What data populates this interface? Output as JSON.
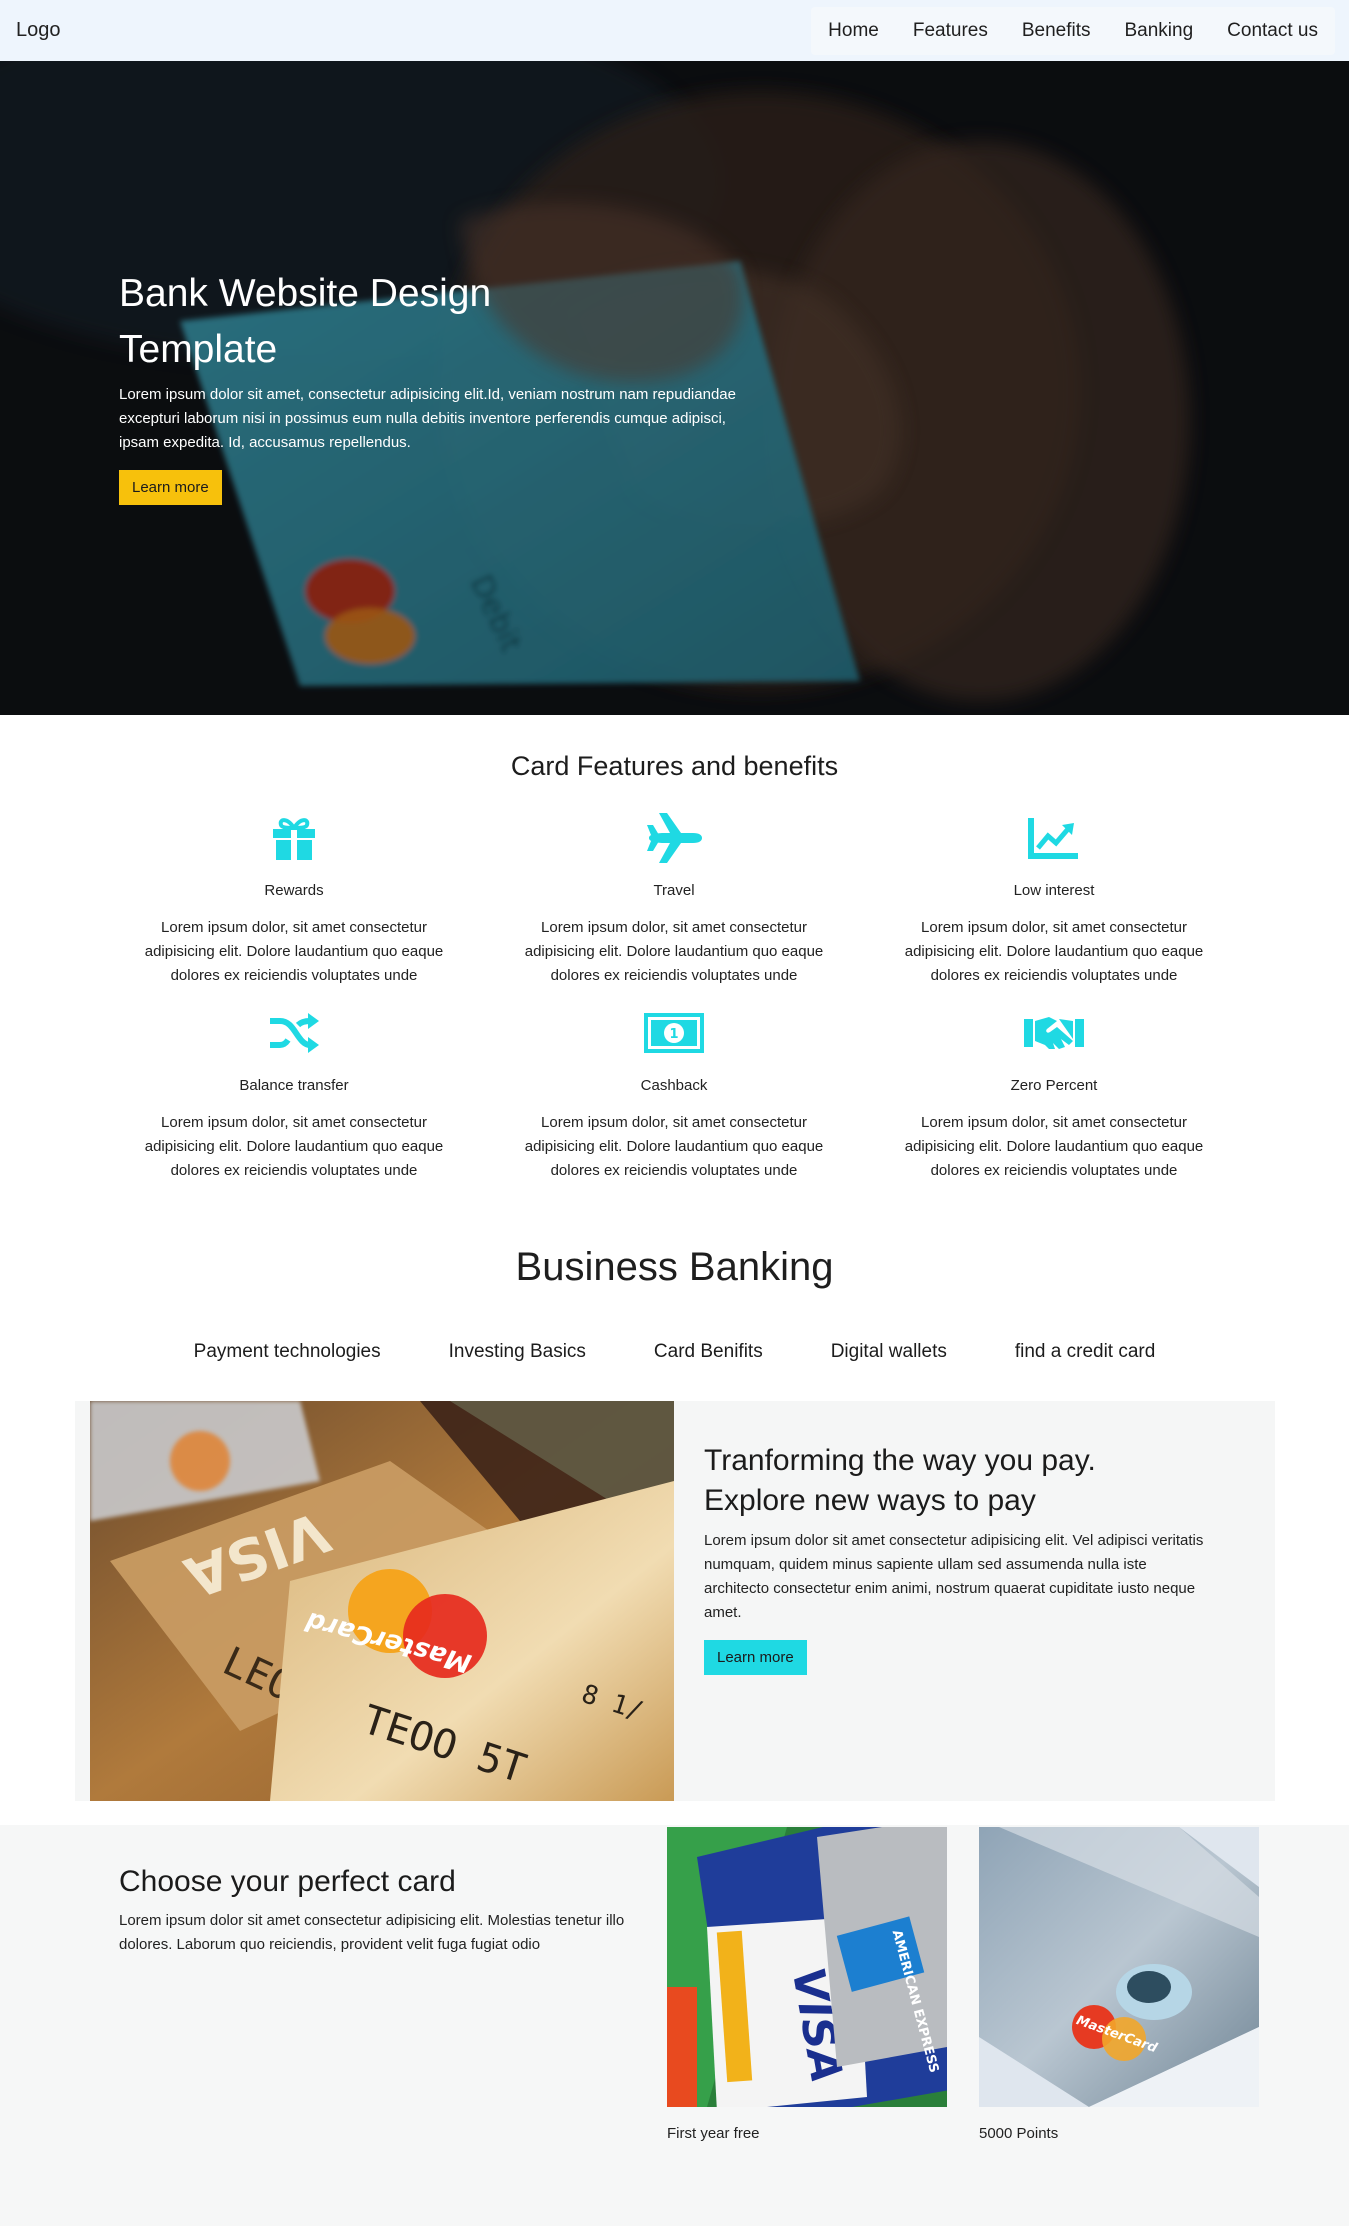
{
  "nav": {
    "logo": "Logo",
    "links": [
      "Home",
      "Features",
      "Benefits",
      "Banking",
      "Contact us"
    ]
  },
  "hero": {
    "title": "Bank Website Design Template",
    "text": "Lorem ipsum dolor sit amet, consectetur adipisicing elit.Id, veniam nostrum nam repudiandae excepturi laborum nisi in possimus eum nulla debitis inventore perferendis cumque adipisci, ipsam expedita. Id, accusamus repellendus.",
    "button": "Learn more"
  },
  "features": {
    "title": "Card Features and benefits",
    "items": [
      {
        "icon": "gift-icon",
        "name": "Rewards",
        "text": "Lorem ipsum dolor, sit amet consectetur adipisicing elit. Dolore laudantium quo eaque dolores ex reiciendis voluptates unde"
      },
      {
        "icon": "plane-icon",
        "name": "Travel",
        "text": "Lorem ipsum dolor, sit amet consectetur adipisicing elit. Dolore laudantium quo eaque dolores ex reiciendis voluptates unde"
      },
      {
        "icon": "chart-line-icon",
        "name": "Low interest",
        "text": "Lorem ipsum dolor, sit amet consectetur adipisicing elit. Dolore laudantium quo eaque dolores ex reiciendis voluptates unde"
      },
      {
        "icon": "shuffle-icon",
        "name": "Balance transfer",
        "text": "Lorem ipsum dolor, sit amet consectetur adipisicing elit. Dolore laudantium quo eaque dolores ex reiciendis voluptates unde"
      },
      {
        "icon": "money-bill-icon",
        "name": "Cashback",
        "text": "Lorem ipsum dolor, sit amet consectetur adipisicing elit. Dolore laudantium quo eaque dolores ex reiciendis voluptates unde"
      },
      {
        "icon": "handshake-icon",
        "name": "Zero Percent",
        "text": "Lorem ipsum dolor, sit amet consectetur adipisicing elit. Dolore laudantium quo eaque dolores ex reiciendis voluptates unde"
      }
    ],
    "icon_color": "#1fd9e3"
  },
  "banking": {
    "title": "Business Banking",
    "tabs": [
      "Payment technologies",
      "Investing Basics",
      "Card Benifits",
      "Digital wallets",
      "find a credit card"
    ],
    "card": {
      "title_line1": "Tranforming the way you pay.",
      "title_line2": "Explore new ways to pay",
      "text": "Lorem ipsum dolor sit amet consectetur adipisicing elit. Vel adipisci veritatis numquam, quidem minus sapiente ullam sed assumenda nulla iste architecto consectetur enim animi, nostrum quaerat cupiditate iusto neque amet.",
      "button": "Learn more"
    }
  },
  "choose": {
    "title": "Choose your perfect card",
    "text": "Lorem ipsum dolor sit amet consectetur adipisicing elit. Molestias tenetur illo dolores. Laborum quo reiciendis, provident velit fuga fugiat odio",
    "cards": [
      {
        "caption": "First year free"
      },
      {
        "caption": "5000 Points"
      }
    ]
  },
  "colors": {
    "accent_yellow": "#f7c10c",
    "accent_cyan": "#1fd9e3",
    "nav_bg": "#eef5fd"
  }
}
